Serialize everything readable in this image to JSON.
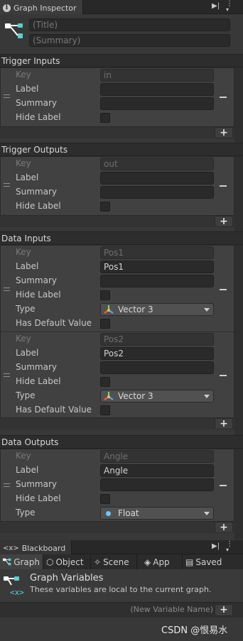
{
  "inspector": {
    "tab_title": "Graph Inspector",
    "title_placeholder": "(Title)",
    "summary_placeholder": "(Summary)"
  },
  "labels": {
    "key": "Key",
    "label": "Label",
    "summary": "Summary",
    "hide_label": "Hide Label",
    "type": "Type",
    "has_default": "Has Default Value",
    "add": "+"
  },
  "trigger_inputs": {
    "title": "Trigger Inputs",
    "key": "in",
    "label": "",
    "summary": ""
  },
  "trigger_outputs": {
    "title": "Trigger Outputs",
    "key": "out",
    "label": "",
    "summary": ""
  },
  "data_inputs": {
    "title": "Data Inputs",
    "items": [
      {
        "key": "Pos1",
        "label": "Pos1",
        "summary": "",
        "type": "Vector 3"
      },
      {
        "key": "Pos2",
        "label": "Pos2",
        "summary": "",
        "type": "Vector 3"
      }
    ]
  },
  "data_outputs": {
    "title": "Data Outputs",
    "key": "Angle",
    "label": "Angle",
    "summary": "",
    "type": "Float"
  },
  "blackboard": {
    "tab_title": "Blackboard",
    "tabs": [
      {
        "label": "Graph",
        "icon": "graph-icon"
      },
      {
        "label": "Object",
        "icon": "object-icon"
      },
      {
        "label": "Scene",
        "icon": "scene-icon"
      },
      {
        "label": "App",
        "icon": "app-icon"
      },
      {
        "label": "Saved",
        "icon": "saved-icon"
      }
    ],
    "section_title": "Graph Variables",
    "section_desc": "These variables are local to the current graph.",
    "new_var_placeholder": "(New Variable Name)"
  },
  "watermark": "CSDN @恨易水",
  "colors": {
    "float_dot": "#6ec6ff",
    "vector_x": "#ff5a5a",
    "vector_y": "#7de05a",
    "vector_z": "#5aa8ff",
    "vector_center": "#f0c040"
  }
}
